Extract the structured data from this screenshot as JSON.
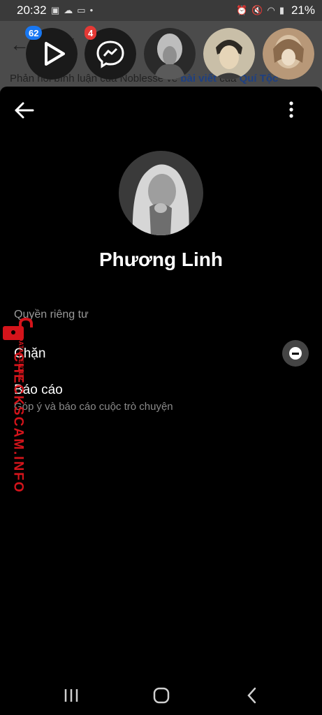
{
  "status_bar": {
    "time": "20:32",
    "left_icons": [
      "image-icon",
      "cloud-icon",
      "cast-icon",
      "dot-icon"
    ],
    "right_icons": [
      "alarm-icon",
      "mute-icon",
      "wifi-icon",
      "signal-icon"
    ],
    "battery": "21%"
  },
  "background_page": {
    "title": "ời",
    "text_prefix": "Phản hồi bình luận của Noblesse về ",
    "link1": "bài viết",
    "text_mid": " của ",
    "link2": "Quí Tộc"
  },
  "chat_heads": [
    {
      "name": "video-chat-head",
      "badge": "62",
      "badge_color": "#1877f2"
    },
    {
      "name": "messenger-chat-head",
      "badge": "4",
      "badge_color": "#e53935"
    },
    {
      "name": "contact-chat-head-1",
      "badge": ""
    },
    {
      "name": "contact-chat-head-2",
      "badge": ""
    },
    {
      "name": "contact-chat-head-3",
      "badge": ""
    }
  ],
  "profile": {
    "name": "Phương Linh"
  },
  "privacy": {
    "section_title": "Quyền riêng tư",
    "block_label": "Chặn",
    "report_label": "Báo cáo",
    "report_sub": "Góp ý và báo cáo cuộc trò chuyện"
  },
  "watermark": {
    "brand": "CHECKSCAM.INFO",
    "sub": "DATA CENTER"
  },
  "colors": {
    "sheet_bg": "#000000",
    "accent_blue": "#1877f2",
    "badge_red": "#e53935",
    "watermark_red": "#d4141b"
  }
}
